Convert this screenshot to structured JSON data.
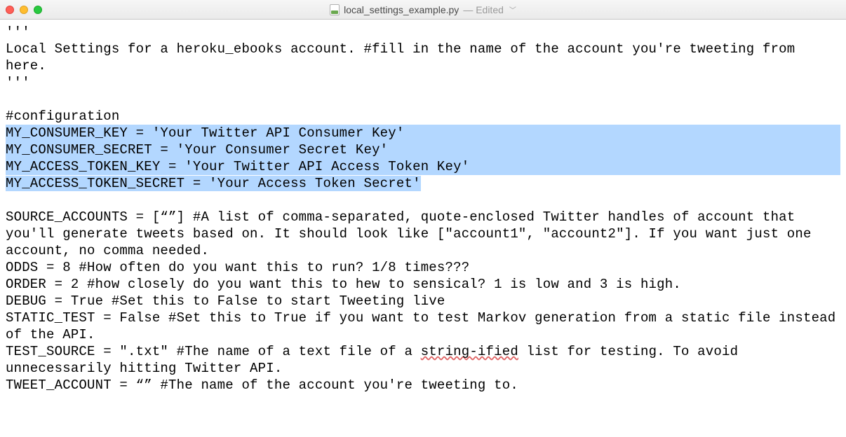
{
  "titlebar": {
    "filename": "local_settings_example.py",
    "edited_label": "— Edited"
  },
  "code": {
    "l1": "'''",
    "l2": "Local Settings for a heroku_ebooks account. #fill in the name of the account you're tweeting from here.",
    "l3": "'''",
    "l4": "",
    "l5": "#configuration",
    "h1": "MY_CONSUMER_KEY = 'Your Twitter API Consumer Key'",
    "h2": "MY_CONSUMER_SECRET = 'Your Consumer Secret Key'",
    "h3": "MY_ACCESS_TOKEN_KEY = 'Your Twitter API Access Token Key'",
    "h4": "MY_ACCESS_TOKEN_SECRET = 'Your Access Token Secret'",
    "l6": "",
    "l7": "SOURCE_ACCOUNTS = [“”] #A list of comma-separated, quote-enclosed Twitter handles of account that you'll generate tweets based on. It should look like [\"account1\", \"account2\"]. If you want just one account, no comma needed.",
    "l8": "ODDS = 8 #How often do you want this to run? 1/8 times???",
    "l9": "ORDER = 2 #how closely do you want this to hew to sensical? 1 is low and 3 is high.",
    "l10": "DEBUG = True #Set this to False to start Tweeting live",
    "l11": "STATIC_TEST = False #Set this to True if you want to test Markov generation from a static file instead of the API.",
    "l12a": "TEST_SOURCE = \".txt\" #The name of a text file of a ",
    "l12b": "string-ified",
    "l12c": " list for testing. To avoid unnecessarily hitting Twitter API.",
    "l13": "TWEET_ACCOUNT = “” #The name of the account you're tweeting to."
  }
}
